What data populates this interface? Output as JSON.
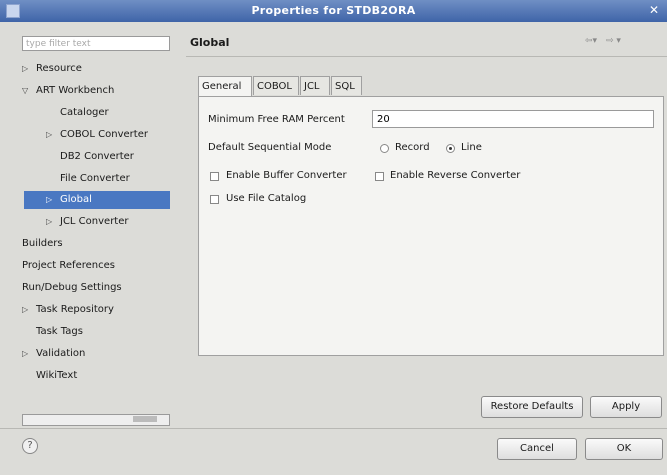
{
  "window": {
    "title": "Properties for STDB2ORA"
  },
  "filter": {
    "placeholder": "type filter text"
  },
  "tree": {
    "items": [
      {
        "label": "Resource",
        "arrow": "▷"
      },
      {
        "label": "ART Workbench",
        "arrow": "▽"
      },
      {
        "label": "Cataloger",
        "arrow": ""
      },
      {
        "label": "COBOL Converter",
        "arrow": "▷"
      },
      {
        "label": "DB2 Converter",
        "arrow": ""
      },
      {
        "label": "File Converter",
        "arrow": ""
      },
      {
        "label": "Global",
        "arrow": "▷"
      },
      {
        "label": "JCL Converter",
        "arrow": "▷"
      },
      {
        "label": "Builders",
        "arrow": ""
      },
      {
        "label": "Project References",
        "arrow": ""
      },
      {
        "label": "Run/Debug Settings",
        "arrow": ""
      },
      {
        "label": "Task Repository",
        "arrow": "▷"
      },
      {
        "label": "Task Tags",
        "arrow": ""
      },
      {
        "label": "Validation",
        "arrow": "▷"
      },
      {
        "label": "WikiText",
        "arrow": ""
      }
    ]
  },
  "header": {
    "title": "Global",
    "back": "⇦▾",
    "forward": "⇨ ▾"
  },
  "tabs": [
    "General",
    "COBOL",
    "JCL",
    "SQL"
  ],
  "form": {
    "ram_label": "Minimum Free RAM Percent",
    "ram_value": "20",
    "seq_label": "Default Sequential Mode",
    "record_label": "Record",
    "line_label": "Line",
    "buffer_label": "Enable Buffer Converter",
    "reverse_label": "Enable Reverse Converter",
    "catalog_label": "Use File Catalog"
  },
  "buttons": {
    "restore": "Restore Defaults",
    "apply": "Apply",
    "cancel": "Cancel",
    "ok": "OK",
    "help": "?"
  }
}
